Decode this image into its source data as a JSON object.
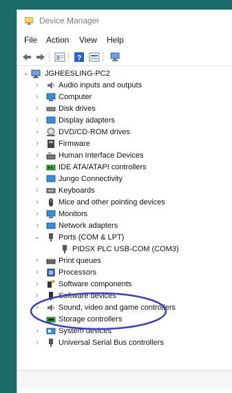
{
  "window": {
    "title": "Device Manager"
  },
  "menubar": {
    "items": [
      "File",
      "Action",
      "View",
      "Help"
    ]
  },
  "tree": {
    "root": "JGHEESLING-PC2",
    "items": [
      "Audio inputs and outputs",
      "Computer",
      "Disk drives",
      "Display adapters",
      "DVD/CD-ROM drives",
      "Firmware",
      "Human Interface Devices",
      "IDE ATA/ATAPI controllers",
      "Jungo Connectivity",
      "Keyboards",
      "Mice and other pointing devices",
      "Monitors",
      "Network adapters",
      "Ports (COM & LPT)",
      "PIDSX PLC USB-COM (COM3)",
      "Print queues",
      "Processors",
      "Software components",
      "Software devices",
      "Sound, video and game controllers",
      "Storage controllers",
      "System devices",
      "Universal Serial Bus controllers"
    ]
  },
  "colors": {
    "background": "#1b6b6b",
    "annotation_circle": "#3a3fc6"
  }
}
